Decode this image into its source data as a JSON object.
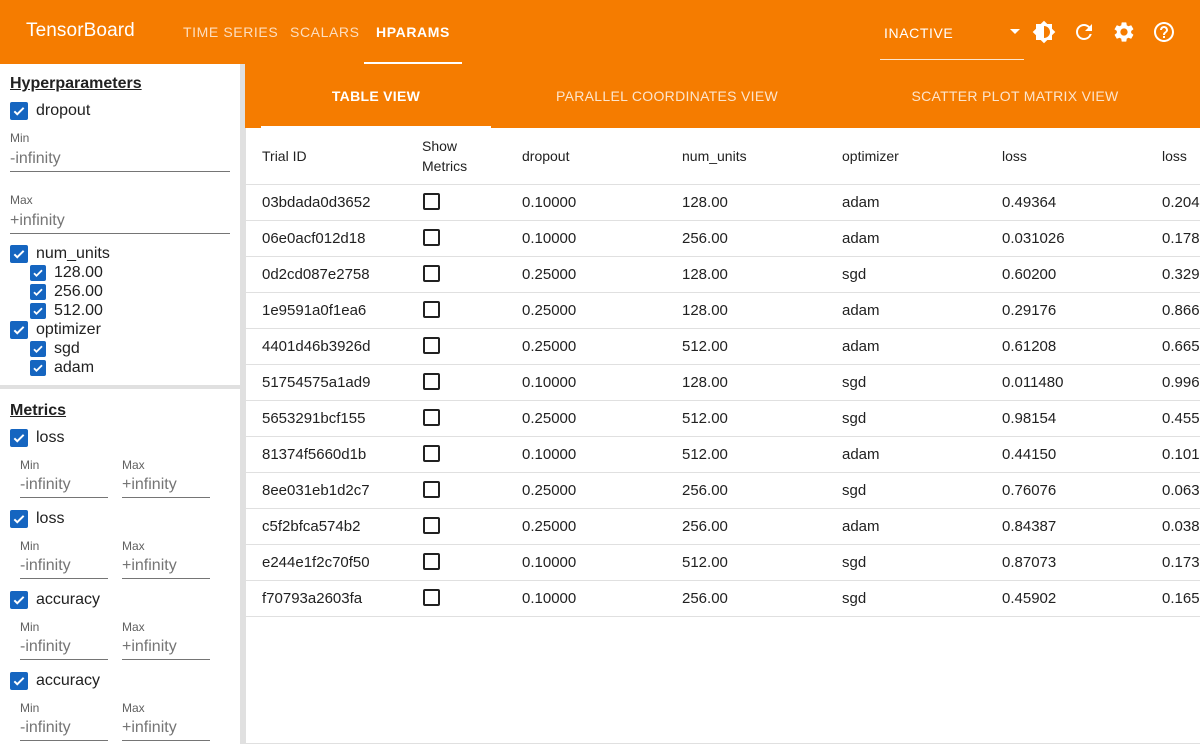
{
  "header": {
    "brand": "TensorBoard",
    "tabs": [
      {
        "label": "Time Series"
      },
      {
        "label": "Scalars"
      },
      {
        "label": "HParams"
      }
    ],
    "active_tab": "HParams",
    "run_selector": {
      "value": "INACTIVE"
    },
    "icons": [
      "theme-toggle-icon",
      "refresh-icon",
      "settings-icon",
      "help-icon"
    ]
  },
  "sidebar": {
    "hparams": {
      "title": "Hyperparameters",
      "dropout": {
        "label": "dropout",
        "min_label": "Min",
        "min_value": "-infinity",
        "max_label": "Max",
        "max_value": "+infinity"
      },
      "num_units": {
        "label": "num_units",
        "values": [
          "128.00",
          "256.00",
          "512.00"
        ]
      },
      "optimizer": {
        "label": "optimizer",
        "values": [
          "sgd",
          "adam"
        ]
      }
    },
    "metrics": {
      "title": "Metrics",
      "items": [
        {
          "label": "loss",
          "min_label": "Min",
          "min_value": "-infinity",
          "max_label": "Max",
          "max_value": "+infinity"
        },
        {
          "label": "loss",
          "min_label": "Min",
          "min_value": "-infinity",
          "max_label": "Max",
          "max_value": "+infinity"
        },
        {
          "label": "accuracy",
          "min_label": "Min",
          "min_value": "-infinity",
          "max_label": "Max",
          "max_value": "+infinity"
        },
        {
          "label": "accuracy",
          "min_label": "Min",
          "min_value": "-infinity",
          "max_label": "Max",
          "max_value": "+infinity"
        }
      ]
    }
  },
  "subtabs": [
    {
      "label": "Table View"
    },
    {
      "label": "Parallel Coordinates View"
    },
    {
      "label": "Scatter Plot Matrix View"
    }
  ],
  "table": {
    "columns": [
      "Trial ID",
      "Show Metrics",
      "dropout",
      "num_units",
      "optimizer",
      "loss",
      "loss"
    ],
    "rows": [
      {
        "id": "03bdada0d3652",
        "dropout": "0.10000",
        "num_units": "128.00",
        "optimizer": "adam",
        "loss": "0.49364",
        "loss2": "0.204"
      },
      {
        "id": "06e0acf012d18",
        "dropout": "0.10000",
        "num_units": "256.00",
        "optimizer": "adam",
        "loss": "0.031026",
        "loss2": "0.178"
      },
      {
        "id": "0d2cd087e2758",
        "dropout": "0.25000",
        "num_units": "128.00",
        "optimizer": "sgd",
        "loss": "0.60200",
        "loss2": "0.329"
      },
      {
        "id": "1e9591a0f1ea6",
        "dropout": "0.25000",
        "num_units": "128.00",
        "optimizer": "adam",
        "loss": "0.29176",
        "loss2": "0.866"
      },
      {
        "id": "4401d46b3926d",
        "dropout": "0.25000",
        "num_units": "512.00",
        "optimizer": "adam",
        "loss": "0.61208",
        "loss2": "0.665"
      },
      {
        "id": "51754575a1ad9",
        "dropout": "0.10000",
        "num_units": "128.00",
        "optimizer": "sgd",
        "loss": "0.011480",
        "loss2": "0.996"
      },
      {
        "id": "5653291bcf155",
        "dropout": "0.25000",
        "num_units": "512.00",
        "optimizer": "sgd",
        "loss": "0.98154",
        "loss2": "0.455"
      },
      {
        "id": "81374f5660d1b",
        "dropout": "0.10000",
        "num_units": "512.00",
        "optimizer": "adam",
        "loss": "0.44150",
        "loss2": "0.101"
      },
      {
        "id": "8ee031eb1d2c7",
        "dropout": "0.25000",
        "num_units": "256.00",
        "optimizer": "sgd",
        "loss": "0.76076",
        "loss2": "0.063"
      },
      {
        "id": "c5f2bfca574b2",
        "dropout": "0.25000",
        "num_units": "256.00",
        "optimizer": "adam",
        "loss": "0.84387",
        "loss2": "0.038"
      },
      {
        "id": "e244e1f2c70f50",
        "dropout": "0.10000",
        "num_units": "512.00",
        "optimizer": "sgd",
        "loss": "0.87073",
        "loss2": "0.173"
      },
      {
        "id": "f70793a2603fa",
        "dropout": "0.10000",
        "num_units": "256.00",
        "optimizer": "sgd",
        "loss": "0.45902",
        "loss2": "0.165"
      }
    ]
  },
  "colors": {
    "brand": "#f57c00",
    "checkbox": "#1565c0"
  }
}
